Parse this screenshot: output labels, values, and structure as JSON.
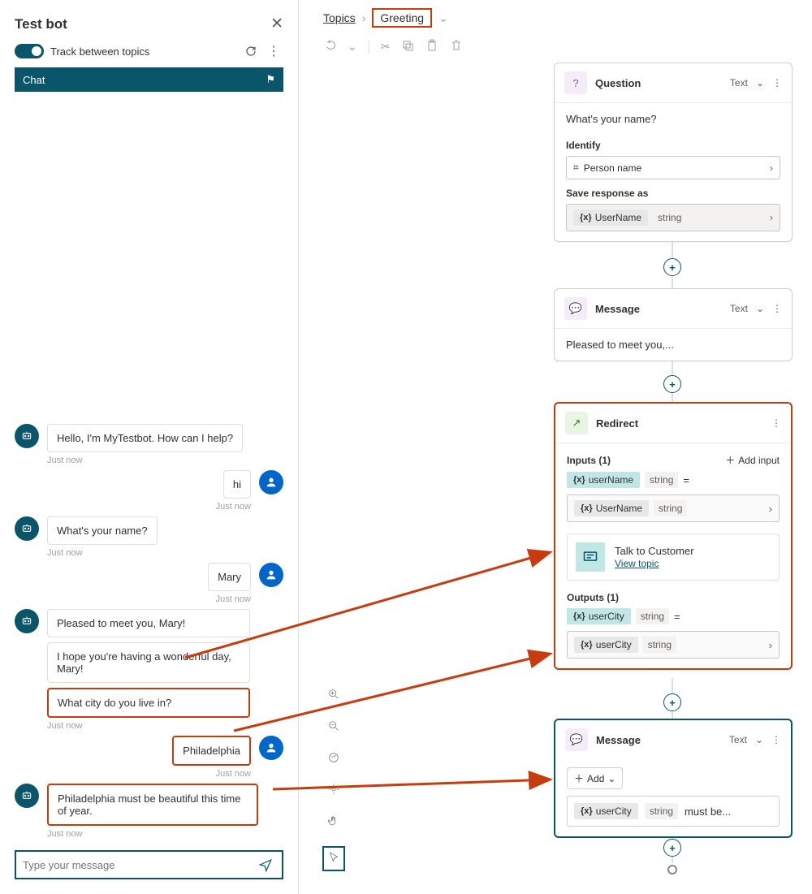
{
  "left": {
    "title": "Test bot",
    "track_label": "Track between topics",
    "chat_tab": "Chat",
    "input_placeholder": "Type your message",
    "ts": "Just now",
    "messages": {
      "bot1": "Hello, I'm MyTestbot. How can I help?",
      "user1": "hi",
      "bot2": "What's your name?",
      "user2": "Mary",
      "bot3a": "Pleased to meet you, Mary!",
      "bot3b": "I hope you're having a wonderful day, Mary!",
      "bot3c": "What city do you live in?",
      "user3": "Philadelphia",
      "bot4": "Philadelphia must be beautiful this time of year."
    }
  },
  "breadcrumb": {
    "root": "Topics",
    "current": "Greeting"
  },
  "nodes": {
    "question": {
      "title": "Question",
      "mode": "Text",
      "prompt": "What's your name?",
      "identify_label": "Identify",
      "identify_value": "Person name",
      "save_label": "Save response as",
      "var": "UserName",
      "var_type": "string"
    },
    "message1": {
      "title": "Message",
      "mode": "Text",
      "text": "Pleased to meet you,..."
    },
    "redirect": {
      "title": "Redirect",
      "inputs_label": "Inputs (1)",
      "add_input": "Add input",
      "in_var": "userName",
      "in_var_type": "string",
      "in_val": "UserName",
      "in_val_type": "string",
      "target": "Talk to Customer",
      "view_topic": "View topic",
      "outputs_label": "Outputs (1)",
      "out_var": "userCity",
      "out_var_type": "string",
      "out_val": "userCity",
      "out_val_type": "string"
    },
    "message2": {
      "title": "Message",
      "mode": "Text",
      "add": "Add",
      "expr_var": "userCity",
      "expr_type": "string",
      "expr_rest": "must be..."
    }
  }
}
